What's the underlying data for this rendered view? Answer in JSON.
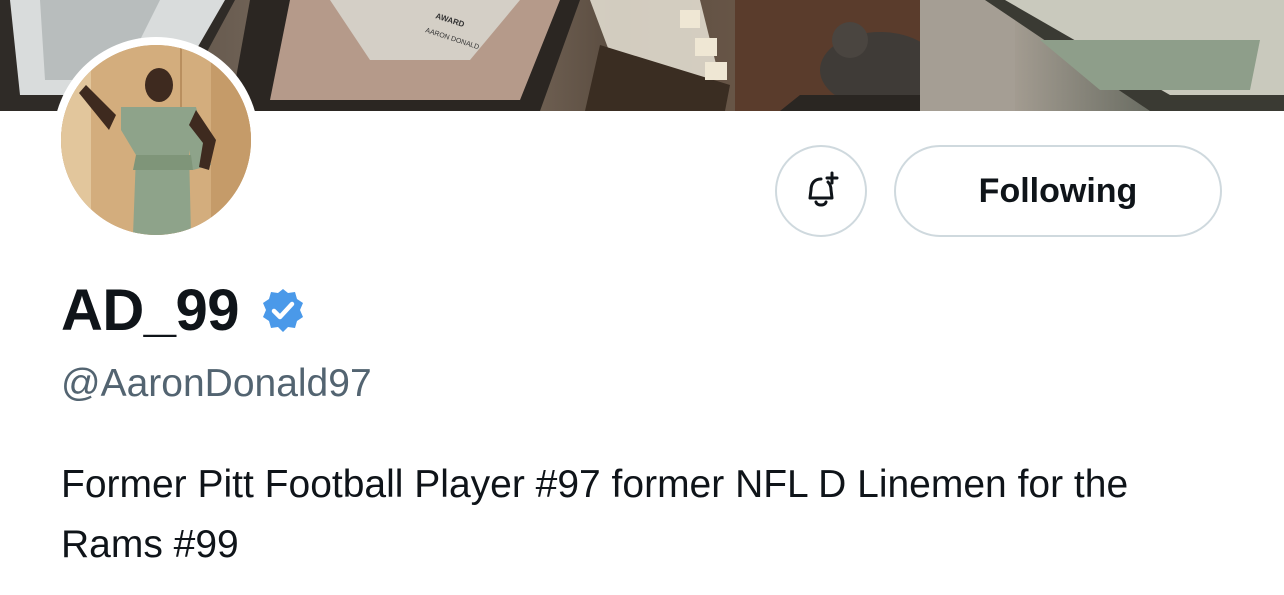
{
  "profile": {
    "display_name": "AD_99",
    "handle": "@AaronDonald97",
    "bio": "Former Pitt Football Player #97 former NFL D Linemen for the Rams #99"
  },
  "actions": {
    "notify_icon": "bell-plus-icon",
    "follow_label": "Following"
  },
  "banner": {
    "plaque_text": [
      "AWARD",
      "AARON DONALD"
    ]
  },
  "colors": {
    "verified": "#4a99e9",
    "handle": "#536471",
    "button_border": "#cfd9de"
  }
}
